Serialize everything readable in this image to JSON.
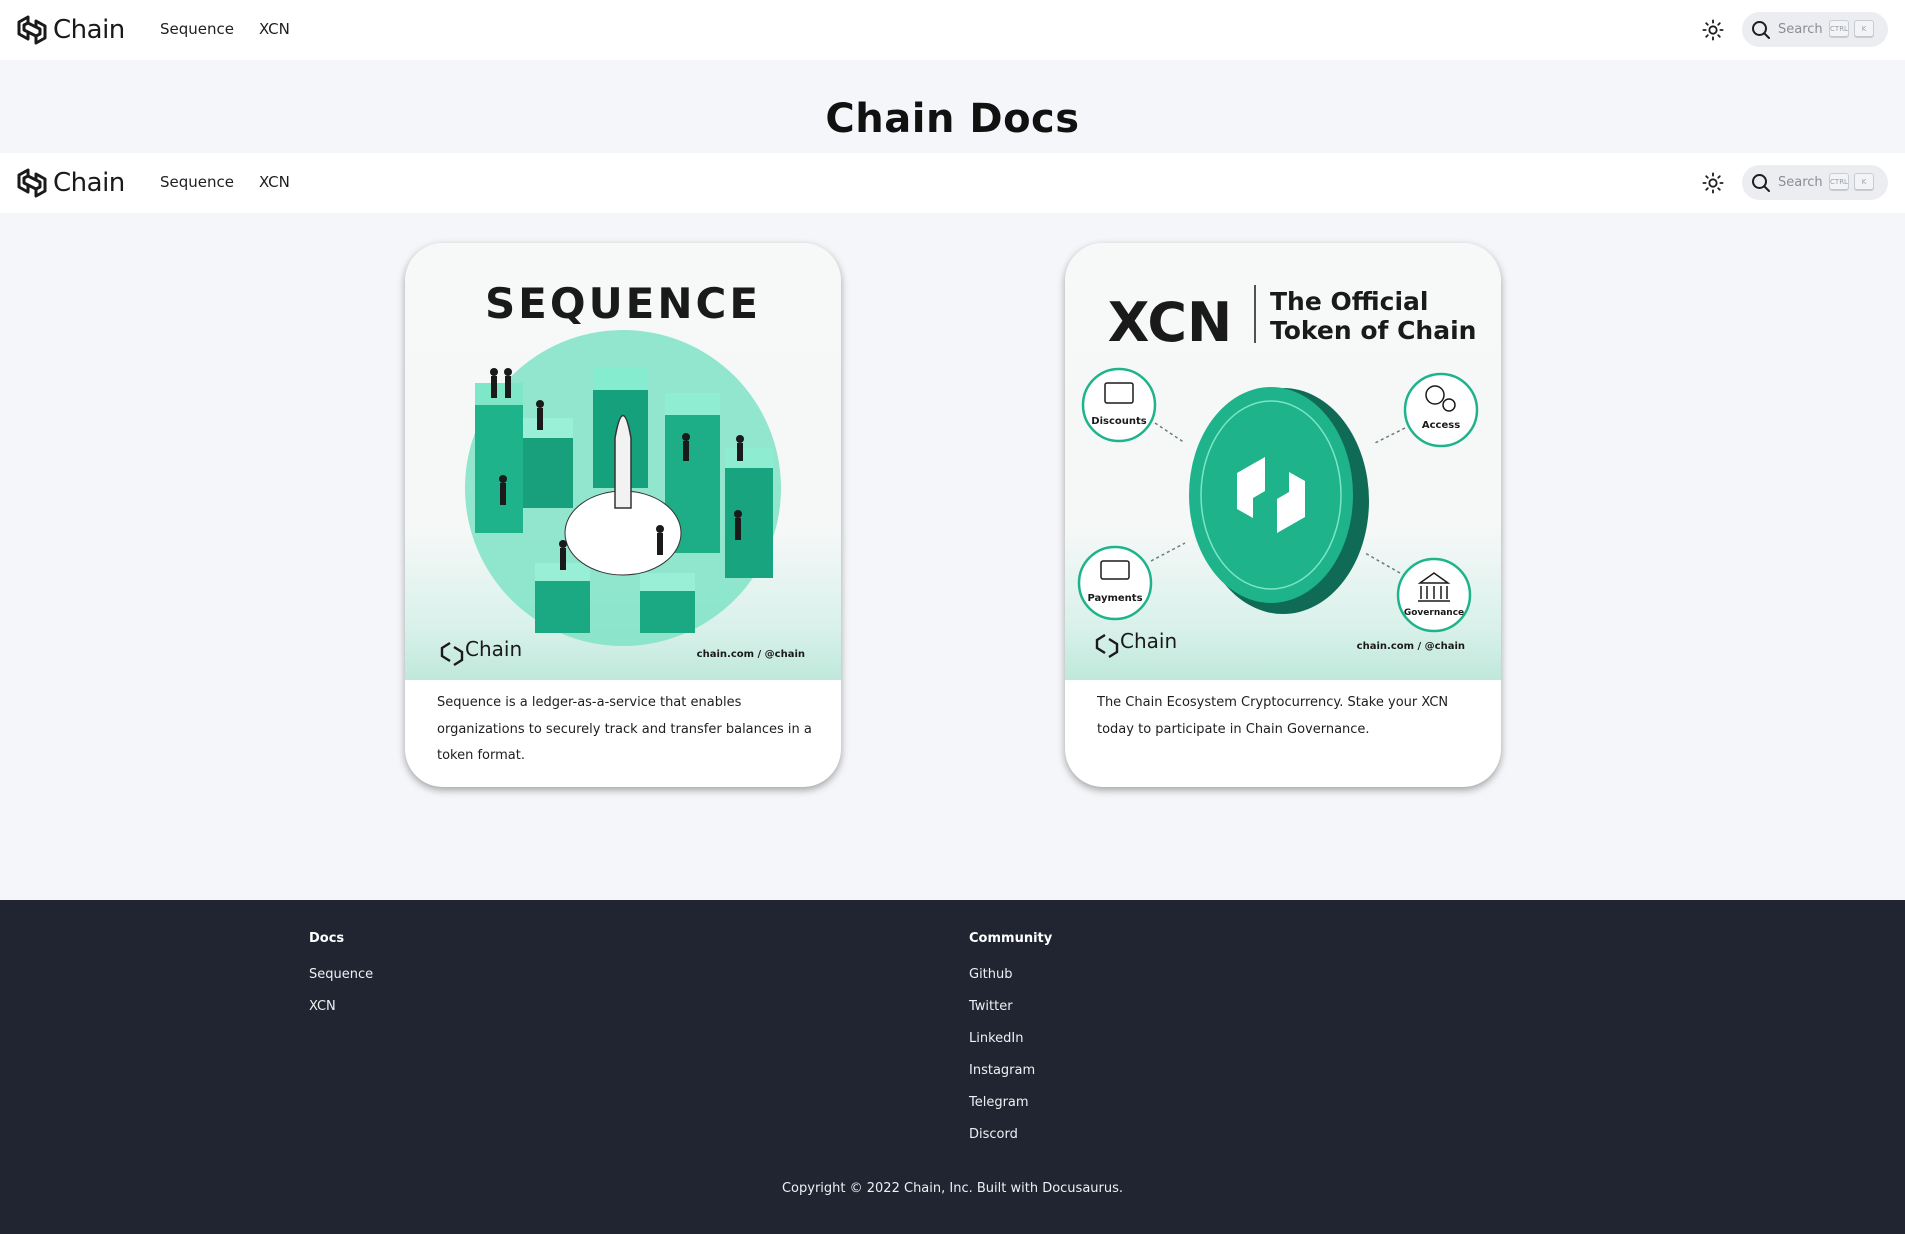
{
  "navbar": {
    "brand": "Chain",
    "links": [
      "Sequence",
      "XCN"
    ],
    "search_placeholder": "Search",
    "kbd_ctrl": "CTRL",
    "kbd_k": "K"
  },
  "hero": {
    "title": "Chain Docs"
  },
  "cards": [
    {
      "image_heading": "SEQUENCE",
      "image_brand": "Chain",
      "image_handle": "chain.com / @chain",
      "description": "Sequence is a ledger-as-a-service that enables organizations to securely track and transfer balances in a token format."
    },
    {
      "image_heading": "XCN",
      "image_subheading_1": "The Official",
      "image_subheading_2": "Token of Chain",
      "badges": [
        "Discounts",
        "Access",
        "Payments",
        "Governance"
      ],
      "image_brand": "Chain",
      "image_handle": "chain.com / @chain",
      "description": "The Chain Ecosystem Cryptocurrency. Stake your XCN today to participate in Chain Governance."
    }
  ],
  "footer": {
    "docs_title": "Docs",
    "docs_links": [
      "Sequence",
      "XCN"
    ],
    "community_title": "Community",
    "community_links": [
      "Github",
      "Twitter",
      "LinkedIn",
      "Instagram",
      "Telegram",
      "Discord"
    ],
    "copyright": "Copyright © 2022 Chain, Inc. Built with Docusaurus."
  },
  "colors": {
    "accent": "#1fb38b",
    "footer_bg": "#202531",
    "page_bg": "#f5f6f9"
  }
}
